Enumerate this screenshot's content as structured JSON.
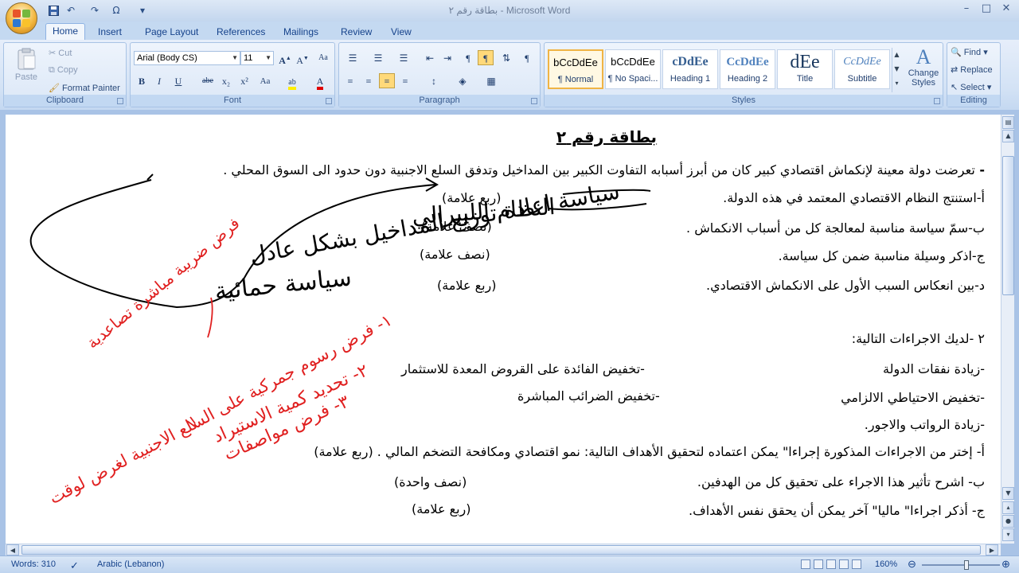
{
  "window": {
    "title": "بطاقة رقم ٢ - Microsoft Word",
    "controls": [
      "–",
      "□",
      "✕"
    ]
  },
  "quick_access": [
    "save-icon",
    "undo-icon",
    "redo-icon",
    "spelling-icon",
    "customize-icon"
  ],
  "tabs": [
    "Home",
    "Insert",
    "Page Layout",
    "References",
    "Mailings",
    "Review",
    "View"
  ],
  "ribbon": {
    "clipboard": {
      "label": "Clipboard",
      "paste": "Paste",
      "cut": "Cut",
      "copy": "Copy",
      "format_painter": "Format Painter"
    },
    "font": {
      "label": "Font",
      "font_name": "Arial (Body CS)",
      "font_size": "11",
      "buttons": [
        "B",
        "I",
        "U",
        "abe",
        "x₂",
        "x²",
        "Aa"
      ]
    },
    "paragraph": {
      "label": "Paragraph"
    },
    "styles": {
      "label": "Styles",
      "items": [
        {
          "sample": "bCcDdEe",
          "name": "¶ Normal"
        },
        {
          "sample": "bCcDdEe",
          "name": "¶ No Spaci..."
        },
        {
          "sample": "cDdEe",
          "name": "Heading 1"
        },
        {
          "sample": "CcDdEe",
          "name": "Heading 2"
        },
        {
          "sample": "dEe",
          "name": "Title"
        },
        {
          "sample": "CcDdEe",
          "name": "Subtitle"
        }
      ],
      "change_styles": "Change Styles"
    },
    "editing": {
      "label": "Editing",
      "find": "Find",
      "replace": "Replace",
      "select": "Select"
    }
  },
  "document": {
    "heading": "بطاقة رقم ٢",
    "q1": {
      "intro": "تعرضت دولة معينة لإنكماش اقتصادي كبير كان من أبرز  أسبابه التفاوت الكبير بين المداخيل  وتدفق السلع الاجنبية دون حدود الى السوق المحلي .",
      "a": "أ-استنتج النظام الاقتصادي المعتمد في هذه الدولة.",
      "a_mark": "(ربع علامة)",
      "b": "ب-سمّ سياسة مناسبة لمعالجة كل من أسباب الانكماش .",
      "b_mark": "(نصف علامة)",
      "c": "ج-اذكر وسيلة مناسبة ضمن كل سياسة.",
      "c_mark": "(نصف علامة)",
      "d": "د-بين انعكاس السبب الأول على الانكماش الاقتصادي.",
      "d_mark": "(ربع علامة)"
    },
    "q2": {
      "intro": "٢ -لديك الاجراءات التالية:",
      "m1_right": "-زيادة نفقات الدولة",
      "m1_left": "-تخفيض الفائدة على القروض المعدة للاستثمار",
      "m2_right": "-تخفيض الاحتياطي الالزامي",
      "m2_left": "-تخفيض الضرائب المباشرة",
      "m3_right": "-زيادة الرواتب والاجور.",
      "a": "أ- إختر من الاجراءات المذكورة إجراءا\" يمكن اعتماده لتحقيق الأهداف التالية: نمو اقتصادي ومكافحة التضخم المالي . (ربع علامة)",
      "b": "ب- اشرح تأثير هذا الاجراء على تحقيق كل من الهدفين.",
      "b_mark": "(نصف واحدة)",
      "c": "ج- أذكر اجراءا\" ماليا\" آخر يمكن أن يحقق نفس الأهداف.",
      "c_mark": "(ربع علامة)"
    },
    "handwriting": {
      "h1": "النظام الليبرالي",
      "h2": "سياسة اعادة توزيع المداخيل بشكل عادل",
      "h3": "سياسة حمائية",
      "h4": "فرض ضريبة مباشرة تصاعدية",
      "h5": "١- فرض رسوم جمركية على السلع الاجنبية لغرض لوقت",
      "h6": "٢- تحديد كمية الاستيراد",
      "h7": "٣- فرض مواصفات"
    }
  },
  "status": {
    "words": "Words: 310",
    "language": "Arabic (Lebanon)",
    "zoom": "160%"
  },
  "colors": {
    "ribbon": "#d3e2f5",
    "title_bar": "#c3d6ee",
    "ink_black": "#000000",
    "ink_red": "#e02020",
    "status_bar": "#c0d5ef"
  }
}
